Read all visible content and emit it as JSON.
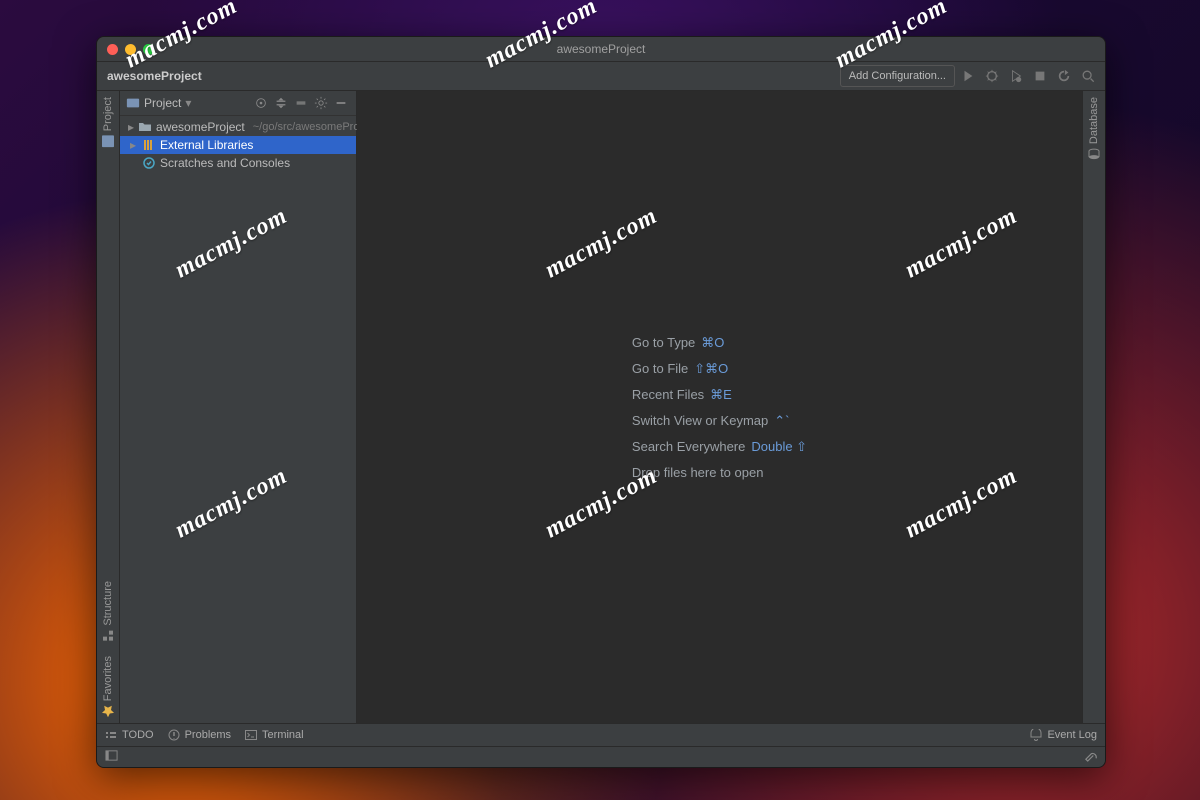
{
  "window": {
    "title": "awesomeProject"
  },
  "breadcrumb": "awesomeProject",
  "toolbar": {
    "add_configuration": "Add Configuration..."
  },
  "left_rail": {
    "top": "Project",
    "structure": "Structure",
    "favorites": "Favorites"
  },
  "right_rail": {
    "database": "Database"
  },
  "project_panel": {
    "title": "Project",
    "tree": [
      {
        "label": "awesomeProject",
        "path": "~/go/src/awesomeProject",
        "icon": "folder",
        "expandable": true,
        "selected": false
      },
      {
        "label": "External Libraries",
        "path": "",
        "icon": "libs",
        "expandable": true,
        "selected": true
      },
      {
        "label": "Scratches and Consoles",
        "path": "",
        "icon": "scratch",
        "expandable": false,
        "selected": false
      }
    ]
  },
  "editor_hints": [
    {
      "text": "Go to Type",
      "kbd": "⌘O"
    },
    {
      "text": "Go to File",
      "kbd": "⇧⌘O"
    },
    {
      "text": "Recent Files",
      "kbd": "⌘E"
    },
    {
      "text": "Switch View or Keymap",
      "kbd": "⌃`"
    },
    {
      "text": "Search Everywhere",
      "kbd": "Double ⇧"
    },
    {
      "text": "Drop files here to open",
      "kbd": ""
    }
  ],
  "bottom": {
    "todo": "TODO",
    "problems": "Problems",
    "terminal": "Terminal",
    "event_log": "Event Log"
  },
  "watermark": "macmj.com"
}
